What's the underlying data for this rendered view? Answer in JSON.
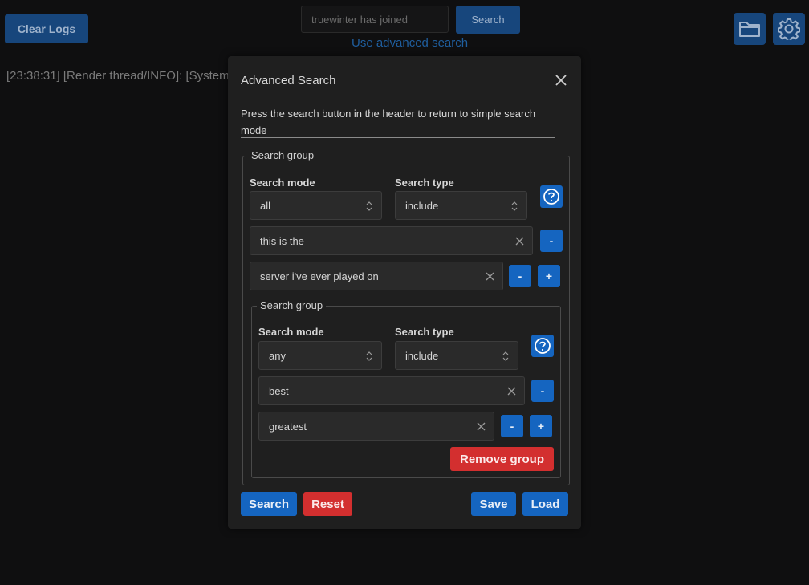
{
  "header": {
    "clear_logs_label": "Clear Logs",
    "search_value": "truewinter has joined",
    "search_button_label": "Search",
    "advanced_link": "Use advanced search",
    "icons": [
      "folder-icon",
      "gear-icon"
    ]
  },
  "log": {
    "line": "[23:38:31] [Render thread/INFO]: [System]"
  },
  "modal": {
    "title": "Advanced Search",
    "description": "Press the search button in the header to return to simple search mode",
    "group": {
      "legend": "Search group",
      "search_mode_label": "Search mode",
      "search_mode_value": "all",
      "search_type_label": "Search type",
      "search_type_value": "include",
      "terms": [
        "this is the",
        "server i've ever played on"
      ],
      "minus_label": "-",
      "plus_label": "+",
      "subgroup": {
        "legend": "Search group",
        "search_mode_label": "Search mode",
        "search_mode_value": "any",
        "search_type_label": "Search type",
        "search_type_value": "include",
        "terms": [
          "best",
          "greatest"
        ],
        "remove_group_label": "Remove group"
      }
    },
    "footer": {
      "search_label": "Search",
      "reset_label": "Reset",
      "save_label": "Save",
      "load_label": "Load"
    }
  },
  "colors": {
    "primary": "#1565c0",
    "danger": "#d32f2f",
    "background": "#0f0f10",
    "modal": "#1f1f1f"
  }
}
